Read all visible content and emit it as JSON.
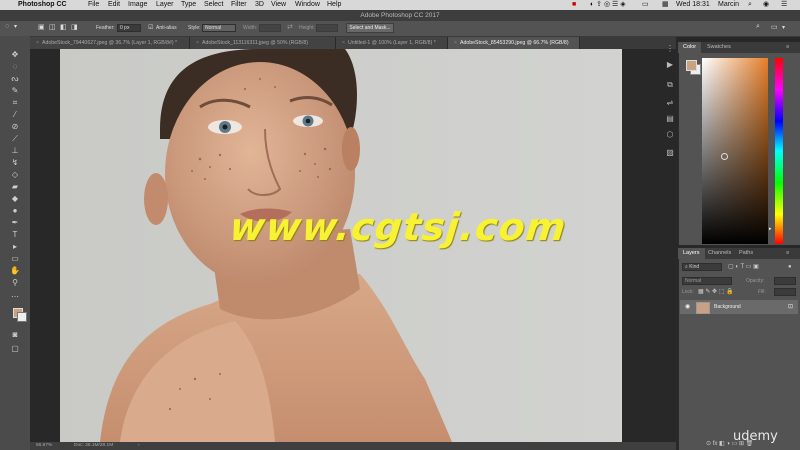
{
  "menubar": {
    "app": "Photoshop CC",
    "items": [
      "File",
      "Edit",
      "Image",
      "Layer",
      "Type",
      "Select",
      "Filter",
      "3D",
      "View",
      "Window",
      "Help"
    ],
    "clock": "Wed 18:31",
    "user": "Marcin"
  },
  "window": {
    "title": "Adobe Photoshop CC 2017"
  },
  "options": {
    "feather_label": "Feather:",
    "feather_value": "0 px",
    "antialias_label": "Anti-alias",
    "style_label": "Style:",
    "style_value": "Normal",
    "width_label": "Width:",
    "height_label": "Height:",
    "select_mask_label": "Select and Mask..."
  },
  "tabs": [
    {
      "label": "AdobeStock_79440627.jpeg @ 36.7% (Layer 1, RGB/8#) *"
    },
    {
      "label": "AdobeStock_113116311.jpeg @ 50% (RGB/8)"
    },
    {
      "label": "Untitled-1 @ 100% (Layer 1, RGB/8) *"
    },
    {
      "label": "AdobeStock_85453290.jpeg @ 66.7% (RGB/8)"
    }
  ],
  "status": {
    "zoom": "66.67%",
    "doc": "Doc: 26.1M/28.1M"
  },
  "panels": {
    "color_tabs": [
      "Color",
      "Swatches"
    ],
    "layers_tabs": [
      "Layers",
      "Channels",
      "Paths"
    ],
    "kind_label": "Kind",
    "blend_mode": "Normal",
    "opacity_label": "Opacity:",
    "lock_label": "Lock:",
    "fill_label": "Fill:",
    "layer_name": "Background"
  },
  "overlay": {
    "watermark": "www.cgtsj.com",
    "brand": "udemy"
  },
  "colors": {
    "foreground": "#c8a382",
    "picker_hue": "#e57f2a"
  }
}
